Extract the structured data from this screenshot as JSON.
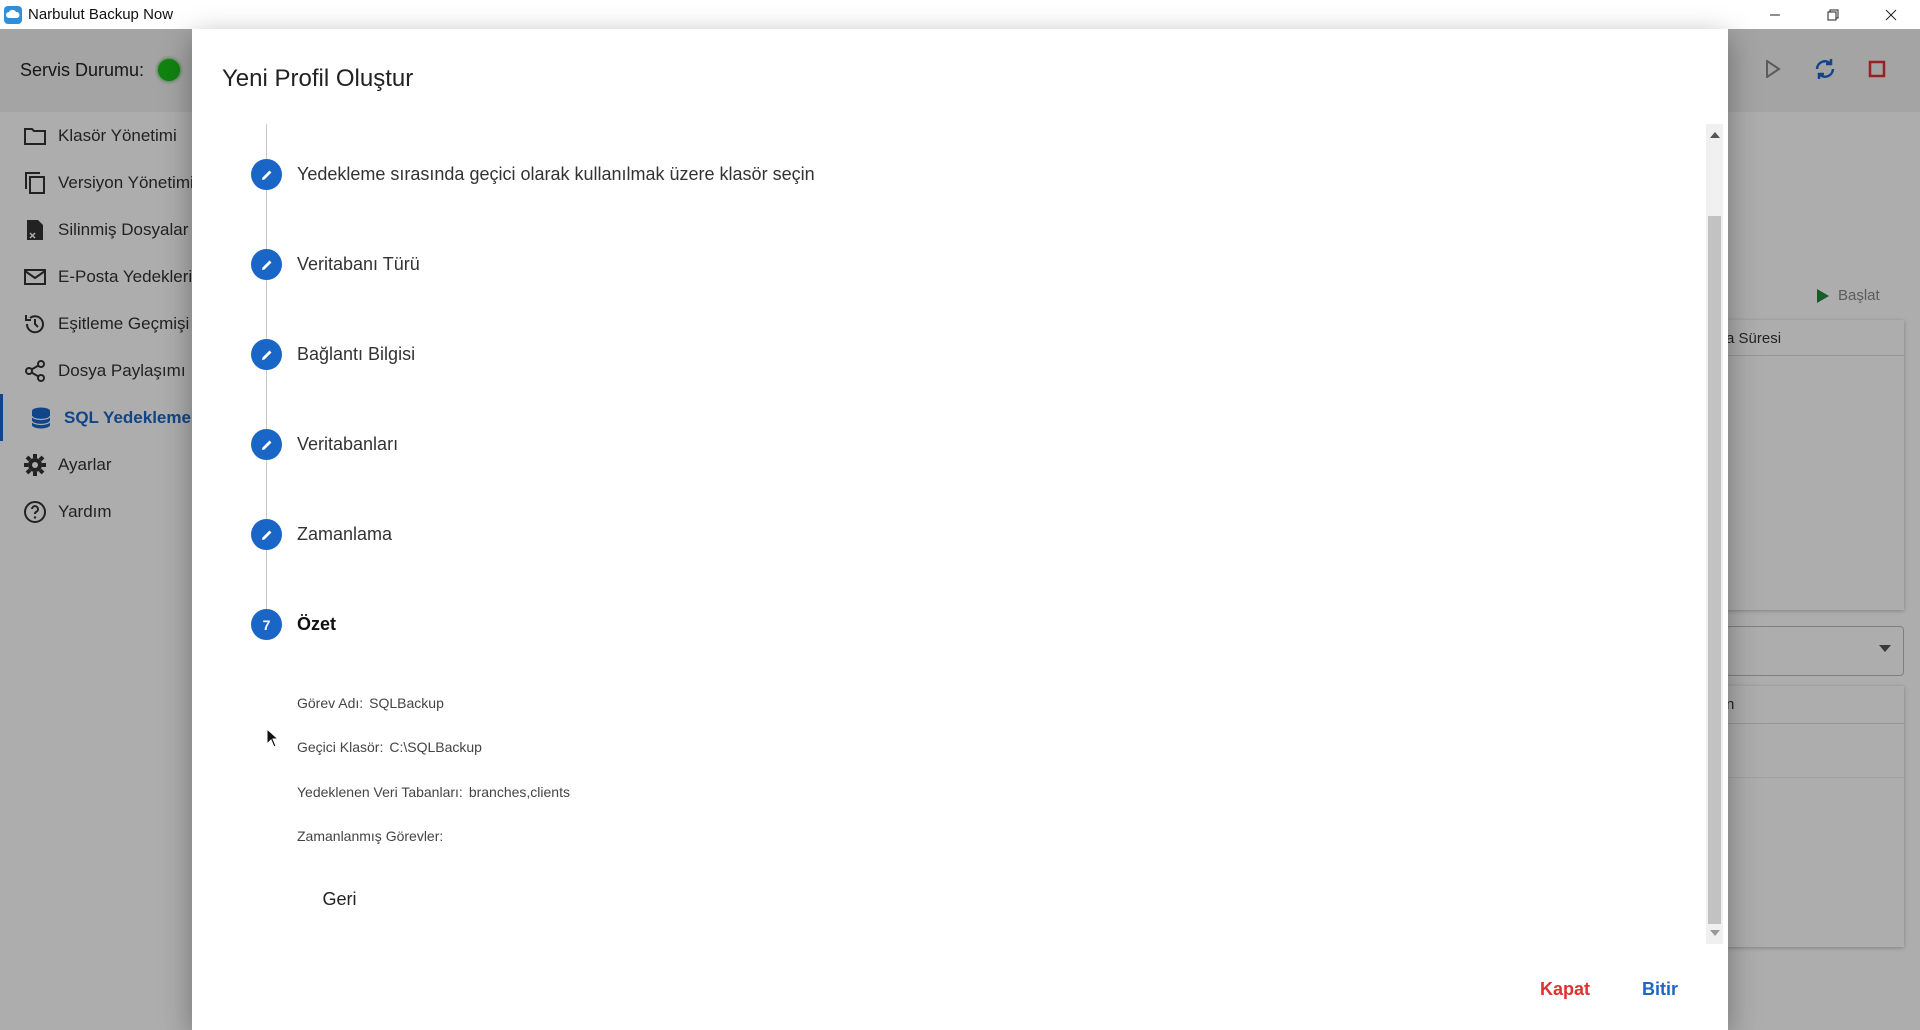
{
  "window": {
    "title": "Narbulut Backup Now",
    "controls": [
      "minimize",
      "restore",
      "close"
    ]
  },
  "header": {
    "service_status_label": "Servis Durumu:",
    "service_status_color": "#19c219"
  },
  "sidebar": {
    "items": [
      {
        "label": "Klasör Yönetimi",
        "icon": "folder-icon",
        "active": false
      },
      {
        "label": "Versiyon Yönetimi",
        "icon": "copy-icon",
        "active": false
      },
      {
        "label": "Silinmiş Dosyalar",
        "icon": "deleted-file-icon",
        "active": false
      },
      {
        "label": "E-Posta Yedekleri",
        "icon": "mail-icon",
        "active": false
      },
      {
        "label": "Eşitleme Geçmişi",
        "icon": "history-icon",
        "active": false
      },
      {
        "label": "Dosya Paylaşımı",
        "icon": "share-icon",
        "active": false
      },
      {
        "label": "SQL Yedekleme",
        "icon": "database-icon",
        "active": true
      },
      {
        "label": "Ayarlar",
        "icon": "gear-icon",
        "active": false
      },
      {
        "label": "Yardım",
        "icon": "help-icon",
        "active": false
      }
    ]
  },
  "background_panel": {
    "start_label": "Başlat",
    "table1_header_fragment": "a Süresi",
    "table2_header_fragment": "n"
  },
  "dialog": {
    "title": "Yeni Profil Oluştur",
    "steps": [
      {
        "label": "Yedekleme sırasında geçici olarak kullanılmak üzere klasör seçin",
        "state": "edit"
      },
      {
        "label": "Veritabanı Türü",
        "state": "edit"
      },
      {
        "label": "Bağlantı Bilgisi",
        "state": "edit"
      },
      {
        "label": "Veritabanları",
        "state": "edit"
      },
      {
        "label": "Zamanlama",
        "state": "edit"
      },
      {
        "label": "Özet",
        "state": "active",
        "number": "7"
      }
    ],
    "summary": {
      "task_name_label": "Görev Adı:",
      "task_name_value": "SQLBackup",
      "temp_folder_label": "Geçici Klasör:",
      "temp_folder_value": "C:\\SQLBackup",
      "databases_label": "Yedeklenen Veri Tabanları:",
      "databases_value": "branches,clients",
      "scheduled_label": "Zamanlanmış Görevler:",
      "scheduled_value": ""
    },
    "back_label": "Geri",
    "close_label": "Kapat",
    "finish_label": "Bitir",
    "accent_color": "#1a66c7",
    "danger_color": "#e03030"
  }
}
